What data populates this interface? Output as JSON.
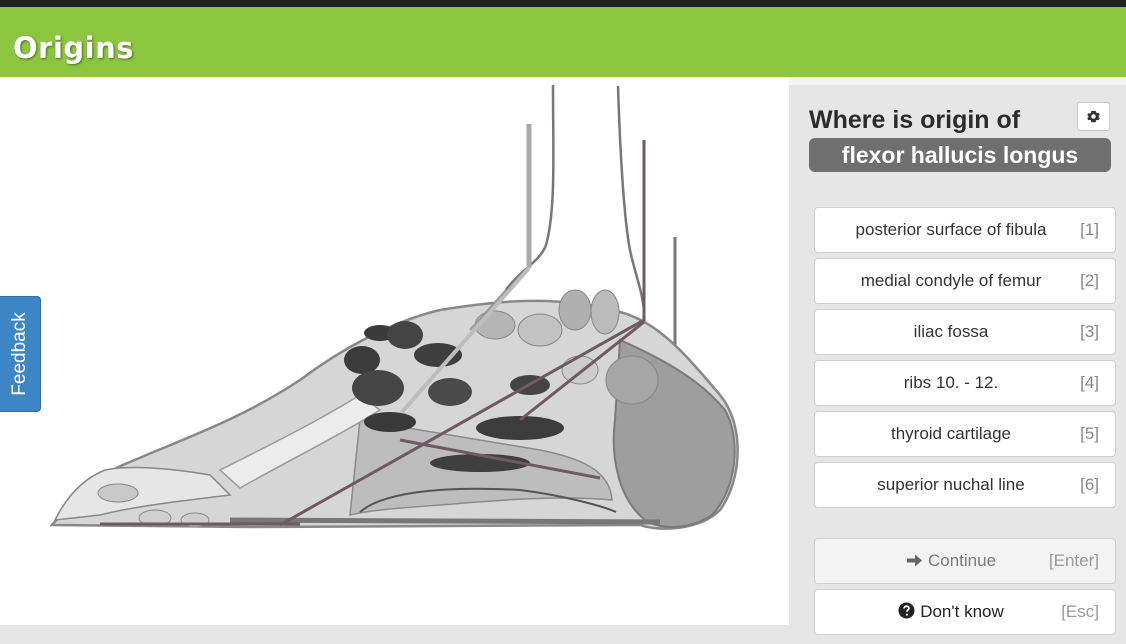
{
  "header": {
    "app_title": "Origins"
  },
  "feedback": {
    "label": "Feedback"
  },
  "quiz": {
    "question": "Where is origin of",
    "term": "flexor hallucis longus",
    "settings_icon": "gear-icon",
    "answers": [
      {
        "label": "posterior surface of fibula",
        "key": "[1]"
      },
      {
        "label": "medial condyle of femur",
        "key": "[2]"
      },
      {
        "label": "iliac fossa",
        "key": "[3]"
      },
      {
        "label": "ribs 10. - 12.",
        "key": "[4]"
      },
      {
        "label": "thyroid cartilage",
        "key": "[5]"
      },
      {
        "label": "superior nuchal line",
        "key": "[6]"
      }
    ],
    "continue": {
      "label": "Continue",
      "key": "[Enter]",
      "icon": "arrow-right-icon"
    },
    "dont_know": {
      "label": "Don't know",
      "key": "[Esc]",
      "icon": "question-circle-icon"
    }
  },
  "colors": {
    "header": "#8cc63f",
    "feedback_tab": "#3d86c6",
    "term_pill": "#6f6f6f",
    "muscle_line": "#6e5a62"
  }
}
